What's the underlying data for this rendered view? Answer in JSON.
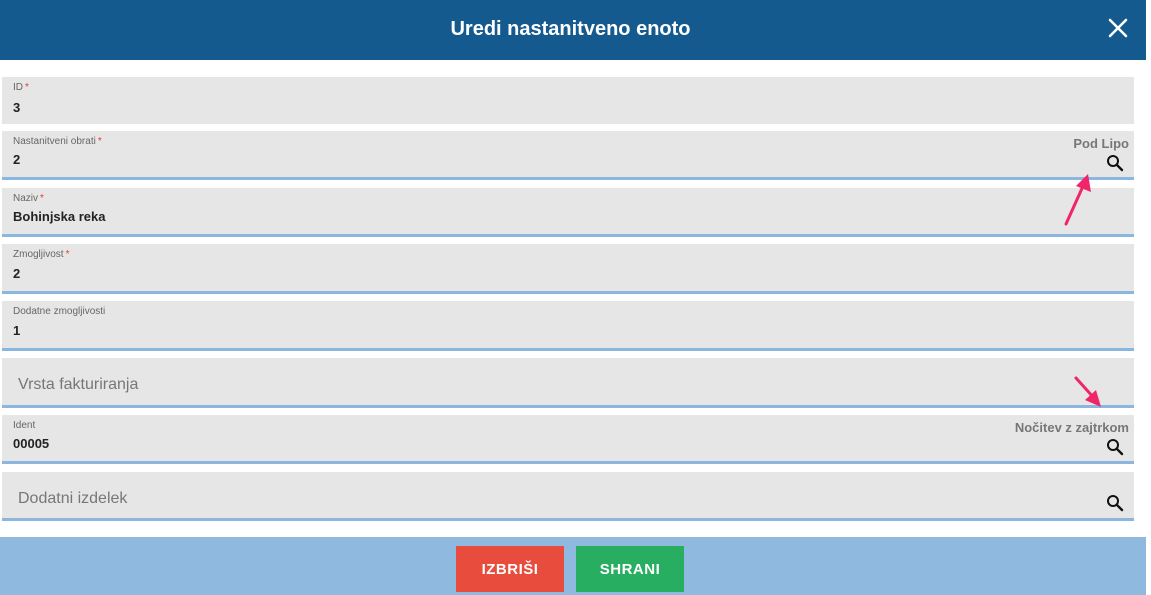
{
  "dialog": {
    "title": "Uredi nastanitveno enoto"
  },
  "fields": {
    "id": {
      "label": "ID",
      "required": "*",
      "value": "3"
    },
    "obrati": {
      "label": "Nastanitveni obrati",
      "required": "*",
      "value": "2",
      "hint": "Pod Lipo"
    },
    "naziv": {
      "label": "Naziv",
      "required": "*",
      "value": "Bohinjska reka"
    },
    "zmogljivost": {
      "label": "Zmogljivost",
      "required": "*",
      "value": "2"
    },
    "dodatne": {
      "label": "Dodatne zmogljivosti",
      "value": "1"
    },
    "vrsta": {
      "placeholder": "Vrsta fakturiranja"
    },
    "ident": {
      "label": "Ident",
      "value": "00005",
      "hint": "Nočitev z zajtrkom"
    },
    "izdelek": {
      "placeholder": "Dodatni izdelek"
    }
  },
  "footer": {
    "delete_label": "IZBRIŠI",
    "save_label": "SHRANI"
  },
  "colors": {
    "header": "#155a8f",
    "footer": "#8fb9de",
    "delete": "#e74c3c",
    "save": "#27ae60",
    "annotation_arrow": "#f0256a"
  },
  "icons": [
    "close-icon",
    "search-icon",
    "annotation-arrow"
  ]
}
